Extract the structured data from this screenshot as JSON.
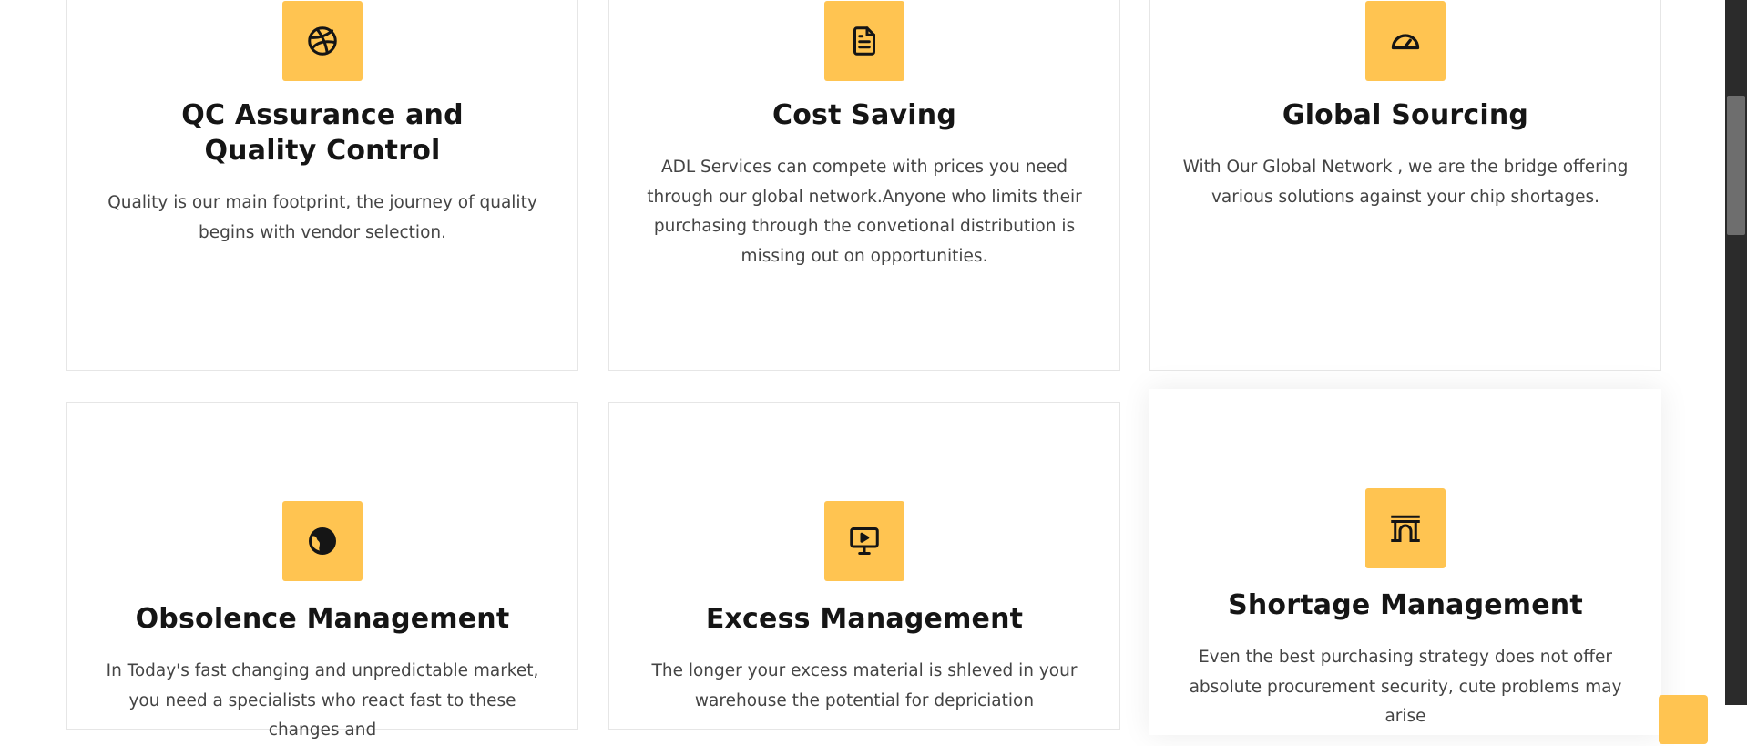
{
  "services": [
    {
      "title": "QC Assurance and Quality Control",
      "description": "Quality is our main footprint, the journey of quality begins with vendor selection.",
      "icon": "dribbble-icon"
    },
    {
      "title": "Cost Saving",
      "description": "ADL Services can compete with prices you need through our global network.Anyone who limits their purchasing through the convetional distribution is missing out on opportunities.",
      "icon": "document-icon"
    },
    {
      "title": "Global Sourcing",
      "description": "With Our Global Network , we are the bridge offering various solutions against your chip shortages.",
      "icon": "speedometer-icon"
    },
    {
      "title": "Obsolence Management",
      "description": "In Today's fast changing and unpredictable market, you need a specialists who react fast to these changes and",
      "icon": "globe-icon"
    },
    {
      "title": "Excess Management",
      "description": "The longer your excess material is shleved in your warehouse the potential for depriciation",
      "icon": "presentation-icon"
    },
    {
      "title": "Shortage Management",
      "description": "Even the best purchasing strategy does not offer absolute procurement security, cute problems may arise",
      "icon": "archway-icon"
    }
  ],
  "colors": {
    "accent": "#ffc451",
    "title": "#151515",
    "text": "#444444",
    "border": "#e6e6e6"
  }
}
